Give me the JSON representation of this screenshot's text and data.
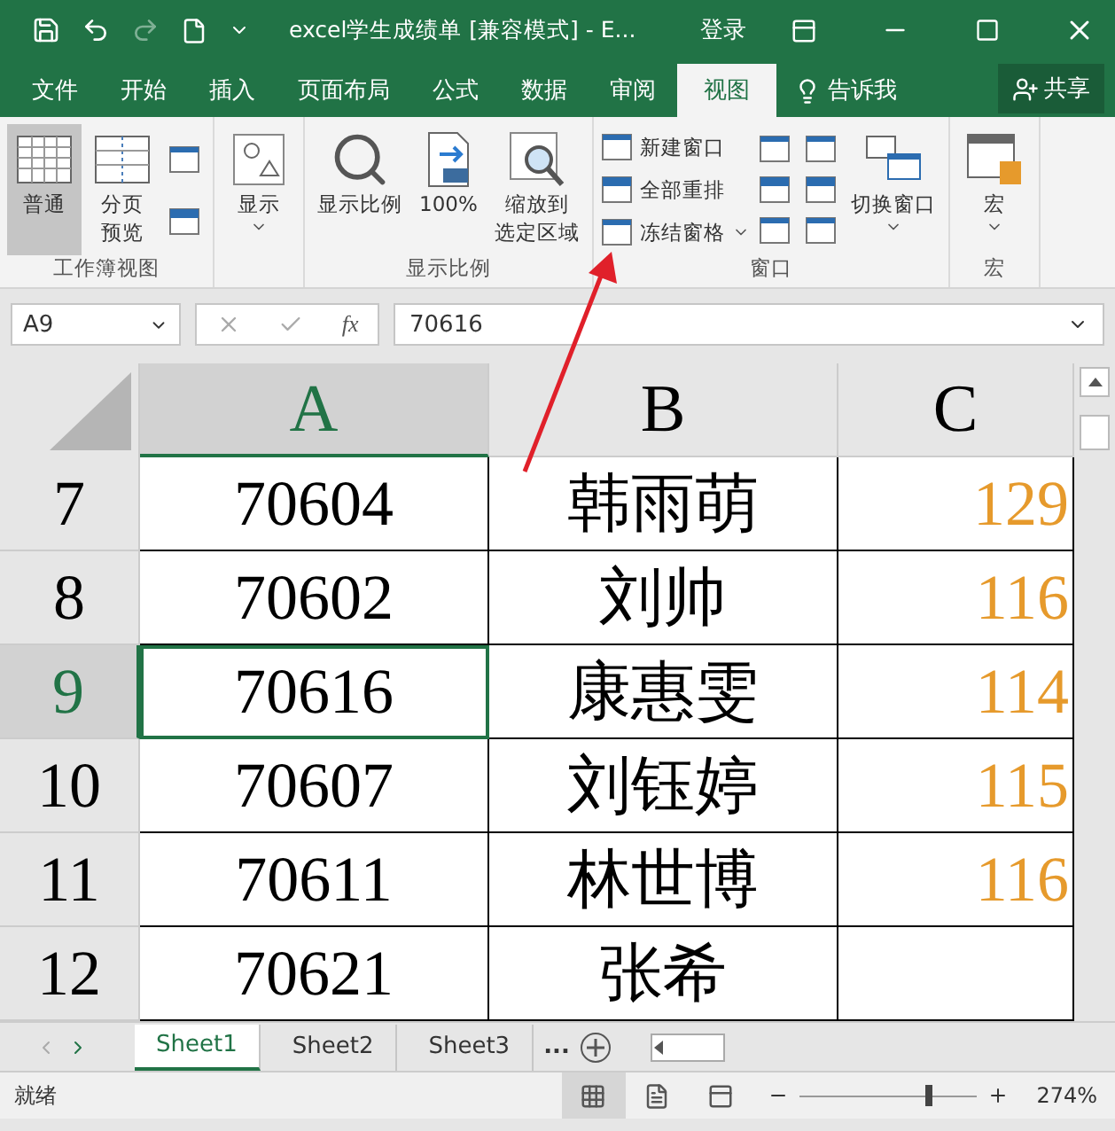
{
  "title_bar": {
    "title": "excel学生成绩单  [兼容模式]  -  E...",
    "login": "登录"
  },
  "tabs": [
    {
      "label": "文件",
      "selected": false
    },
    {
      "label": "开始",
      "selected": false
    },
    {
      "label": "插入",
      "selected": false
    },
    {
      "label": "页面布局",
      "selected": false
    },
    {
      "label": "公式",
      "selected": false
    },
    {
      "label": "数据",
      "selected": false
    },
    {
      "label": "审阅",
      "selected": false
    },
    {
      "label": "视图",
      "selected": true
    }
  ],
  "tell_me": "告诉我",
  "share": "共享",
  "ribbon": [
    {
      "label": "工作簿视图",
      "items": [
        {
          "kind": "large",
          "lines": [
            "普通"
          ],
          "selected": true,
          "dropdown": false
        },
        {
          "kind": "large",
          "lines": [
            "分页",
            "预览"
          ],
          "selected": false,
          "dropdown": false
        },
        {
          "kind": "icons"
        }
      ]
    },
    {
      "items": [
        {
          "kind": "large",
          "lines": [
            "显示"
          ],
          "selected": false,
          "dropdown": true
        }
      ]
    },
    {
      "label": "显示比例",
      "items": [
        {
          "kind": "large",
          "lines": [
            "显示比例"
          ],
          "selected": false,
          "dropdown": false
        },
        {
          "kind": "large",
          "lines": [
            "100%"
          ],
          "selected": false,
          "dropdown": false
        },
        {
          "kind": "large",
          "lines": [
            "缩放到",
            "选定区域"
          ],
          "selected": false,
          "dropdown": false
        }
      ]
    },
    {
      "label": "窗口",
      "items": [
        {
          "kind": "small",
          "rows": [
            {
              "label": "新建窗口",
              "dropdown": false
            },
            {
              "label": "全部重排",
              "dropdown": false
            },
            {
              "label": "冻结窗格",
              "dropdown": true
            }
          ]
        },
        {
          "kind": "icons"
        },
        {
          "kind": "icons"
        },
        {
          "kind": "large",
          "lines": [
            "切换窗口"
          ],
          "selected": false,
          "dropdown": true
        }
      ]
    },
    {
      "label": "宏",
      "items": [
        {
          "kind": "large",
          "lines": [
            "宏"
          ],
          "selected": false,
          "dropdown": true
        }
      ]
    }
  ],
  "formula_bar": {
    "name_box": "A9",
    "fx": "fx",
    "value": "70616"
  },
  "columns": [
    {
      "label": "A",
      "selected": true
    },
    {
      "label": "B",
      "selected": false
    },
    {
      "label": "C",
      "selected": false
    }
  ],
  "rows": [
    {
      "number": "7",
      "selected": false,
      "cells": [
        "70604",
        "韩雨萌",
        "129"
      ]
    },
    {
      "number": "8",
      "selected": false,
      "cells": [
        "70602",
        "刘帅",
        "116"
      ]
    },
    {
      "number": "9",
      "selected": true,
      "cells": [
        "70616",
        "康惠雯",
        "114"
      ]
    },
    {
      "number": "10",
      "selected": false,
      "cells": [
        "70607",
        "刘钰婷",
        "115"
      ]
    },
    {
      "number": "11",
      "selected": false,
      "cells": [
        "70611",
        "林世博",
        "116"
      ]
    },
    {
      "number": "12",
      "selected": false,
      "cells": [
        "70621",
        "张希",
        ""
      ]
    }
  ],
  "sheets": [
    {
      "label": "Sheet1",
      "selected": true
    },
    {
      "label": "Sheet2",
      "selected": false
    },
    {
      "label": "Sheet3",
      "selected": false
    }
  ],
  "more_sheets": "...",
  "status_bar": {
    "status": "就绪",
    "views": [
      {
        "kind": "normal",
        "selected": true
      },
      {
        "kind": "layout",
        "selected": false
      },
      {
        "kind": "pagebreak",
        "selected": false
      }
    ],
    "level": 0.73,
    "zoom": "274%"
  }
}
